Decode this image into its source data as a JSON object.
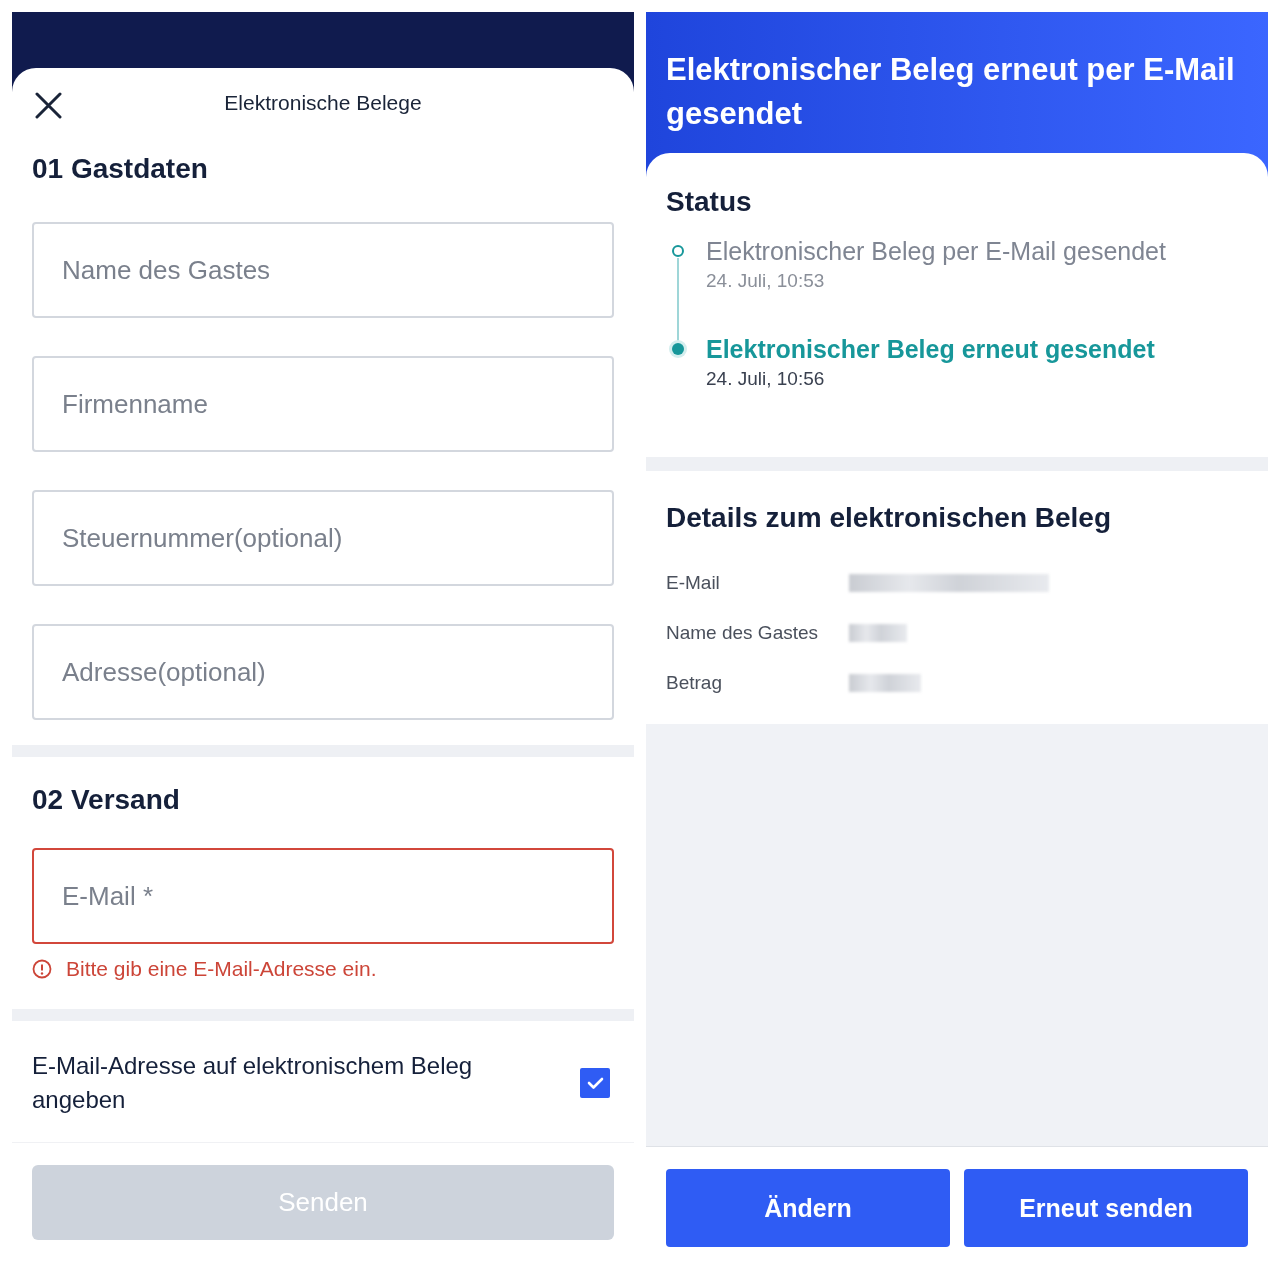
{
  "form": {
    "title": "Elektronische Belege",
    "sections": [
      {
        "heading": "01 Gastdaten",
        "fields": [
          {
            "placeholder": "Name des Gastes",
            "invalid": false
          },
          {
            "placeholder": "Firmenname",
            "invalid": false
          },
          {
            "placeholder": "Steuernummer(optional)",
            "invalid": false
          },
          {
            "placeholder": "Adresse(optional)",
            "invalid": false
          }
        ]
      },
      {
        "heading": "02 Versand",
        "fields": [
          {
            "placeholder": "E-Mail *",
            "invalid": true,
            "error": "Bitte gib eine E-Mail-Adresse ein."
          }
        ]
      }
    ],
    "option": {
      "label": "E-Mail-Adresse auf elektronischem Beleg angeben",
      "checked": true
    },
    "submit": {
      "label": "Senden",
      "disabled": true
    }
  },
  "status_page": {
    "title": "Elektronischer Beleg erneut per E-Mail gesendet",
    "status_heading": "Status",
    "events": [
      {
        "text": "Elektronischer Beleg per E-Mail gesendet",
        "time": "24. Juli, 10:53",
        "current": false
      },
      {
        "text": "Elektronischer Beleg erneut gesendet",
        "time": "24. Juli, 10:56",
        "current": true
      }
    ],
    "details_heading": "Details zum elektronischen Beleg",
    "details": [
      {
        "label": "E-Mail"
      },
      {
        "label": "Name des Gastes"
      },
      {
        "label": "Betrag"
      }
    ],
    "buttons": [
      {
        "label": "Ändern"
      },
      {
        "label": "Erneut senden"
      }
    ]
  }
}
